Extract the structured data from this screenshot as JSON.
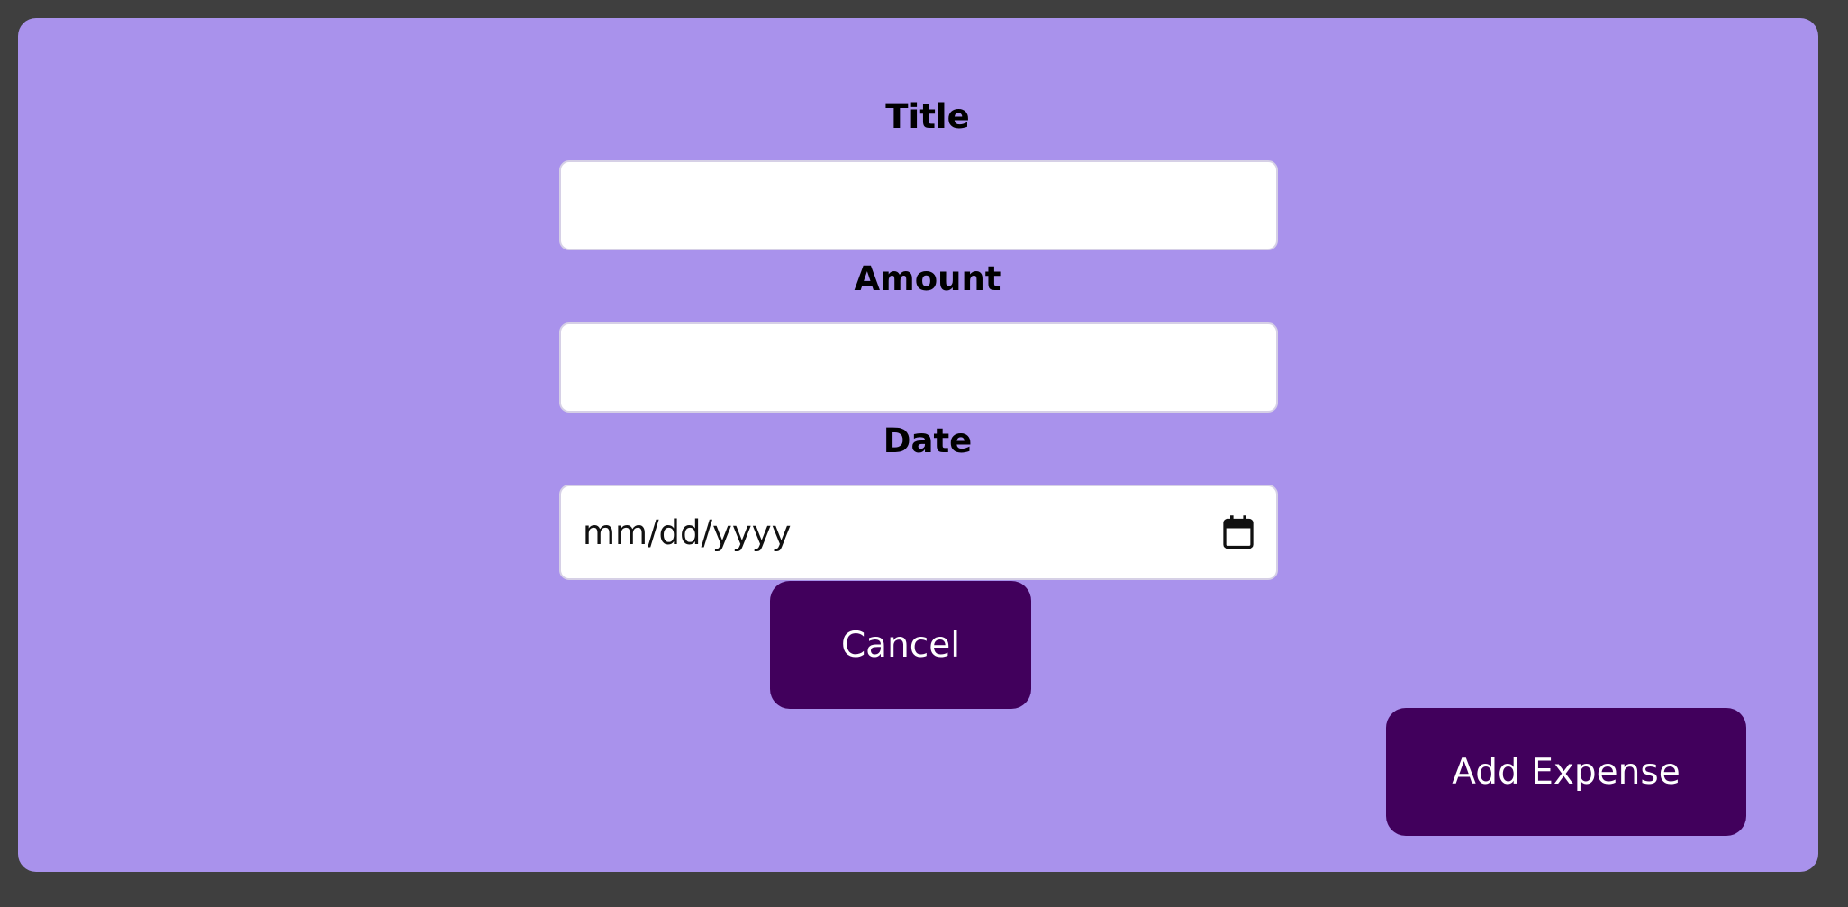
{
  "form": {
    "title_label": "Title",
    "title_value": "",
    "amount_label": "Amount",
    "amount_value": "",
    "date_label": "Date",
    "date_placeholder": "mm/dd/yyyy",
    "date_icon": "calendar-icon",
    "cancel_label": "Cancel",
    "submit_label": "Add Expense"
  },
  "colors": {
    "page_background": "#3f3f3f",
    "card_background": "#a992ec",
    "button_background": "#41005c",
    "button_text": "#ffffff",
    "input_background": "#ffffff"
  }
}
